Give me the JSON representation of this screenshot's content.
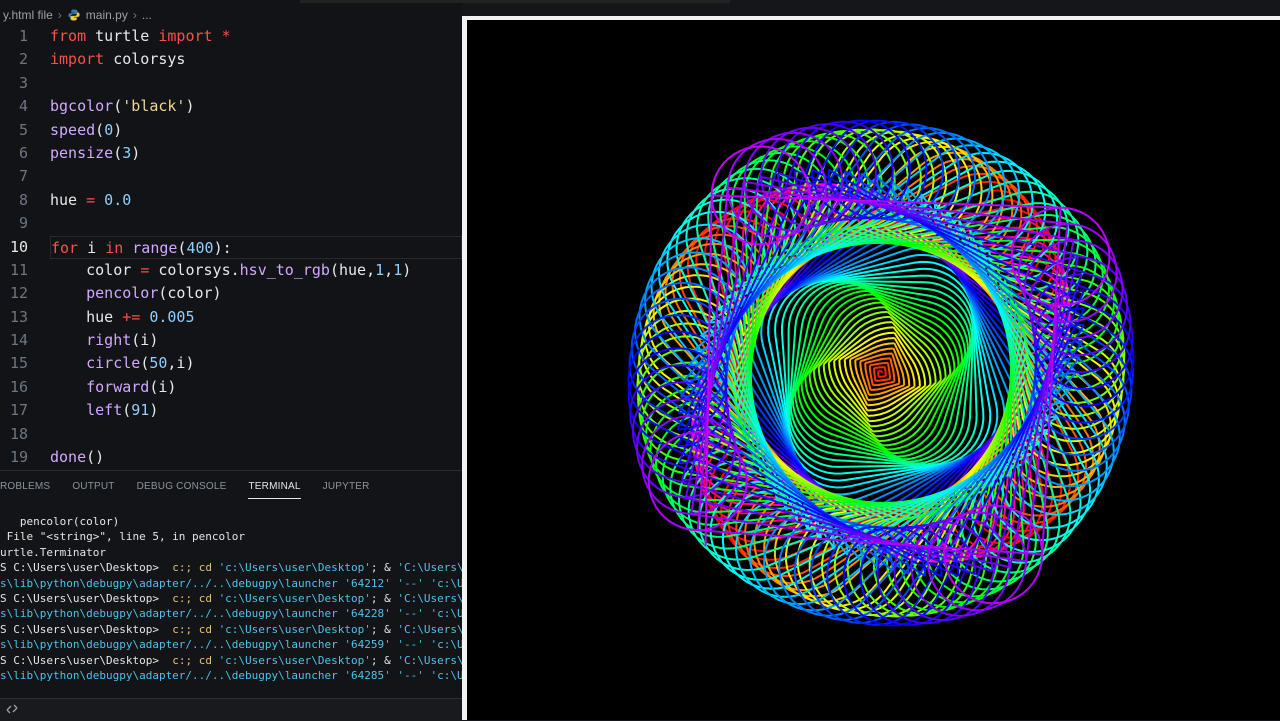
{
  "breadcrumb": {
    "folder": "y.html file",
    "file": "main.py",
    "more": "..."
  },
  "editor": {
    "lines": [
      {
        "n": "1",
        "tokens": [
          [
            "kw",
            "from"
          ],
          [
            "id",
            " turtle "
          ],
          [
            "kw",
            "import"
          ],
          [
            "op",
            " *"
          ]
        ]
      },
      {
        "n": "2",
        "tokens": [
          [
            "kw",
            "import"
          ],
          [
            "id",
            " colorsys"
          ]
        ]
      },
      {
        "n": "3",
        "tokens": []
      },
      {
        "n": "4",
        "tokens": [
          [
            "fn",
            "bgcolor"
          ],
          [
            "id",
            "("
          ],
          [
            "str",
            "'black'"
          ],
          [
            "id",
            ")"
          ]
        ]
      },
      {
        "n": "5",
        "tokens": [
          [
            "fn",
            "speed"
          ],
          [
            "id",
            "("
          ],
          [
            "num",
            "0"
          ],
          [
            "id",
            ")"
          ]
        ]
      },
      {
        "n": "6",
        "tokens": [
          [
            "fn",
            "pensize"
          ],
          [
            "id",
            "("
          ],
          [
            "num",
            "3"
          ],
          [
            "id",
            ")"
          ]
        ]
      },
      {
        "n": "7",
        "tokens": []
      },
      {
        "n": "8",
        "tokens": [
          [
            "id",
            "hue "
          ],
          [
            "op",
            "="
          ],
          [
            "num",
            " 0.0"
          ]
        ]
      },
      {
        "n": "9",
        "tokens": []
      },
      {
        "n": "10",
        "tokens": [
          [
            "kw",
            "for"
          ],
          [
            "id",
            " i "
          ],
          [
            "kw",
            "in"
          ],
          [
            "fn",
            " range"
          ],
          [
            "id",
            "("
          ],
          [
            "num",
            "400"
          ],
          [
            "id",
            "):"
          ]
        ]
      },
      {
        "n": "11",
        "tokens": [
          [
            "id",
            "    color "
          ],
          [
            "op",
            "="
          ],
          [
            "id",
            " colorsys."
          ],
          [
            "fn",
            "hsv_to_rgb"
          ],
          [
            "id",
            "(hue,"
          ],
          [
            "num",
            "1"
          ],
          [
            "id",
            ","
          ],
          [
            "num",
            "1"
          ],
          [
            "id",
            ")"
          ]
        ]
      },
      {
        "n": "12",
        "tokens": [
          [
            "fn",
            "    pencolor"
          ],
          [
            "id",
            "(color)"
          ]
        ]
      },
      {
        "n": "13",
        "tokens": [
          [
            "id",
            "    hue "
          ],
          [
            "op",
            "+="
          ],
          [
            "num",
            " 0.005"
          ]
        ]
      },
      {
        "n": "14",
        "tokens": [
          [
            "fn",
            "    right"
          ],
          [
            "id",
            "(i)"
          ]
        ]
      },
      {
        "n": "15",
        "tokens": [
          [
            "fn",
            "    circle"
          ],
          [
            "id",
            "("
          ],
          [
            "num",
            "50"
          ],
          [
            "id",
            ",i)"
          ]
        ]
      },
      {
        "n": "16",
        "tokens": [
          [
            "fn",
            "    forward"
          ],
          [
            "id",
            "(i)"
          ]
        ]
      },
      {
        "n": "17",
        "tokens": [
          [
            "fn",
            "    left"
          ],
          [
            "id",
            "("
          ],
          [
            "num",
            "91"
          ],
          [
            "id",
            ")"
          ]
        ]
      },
      {
        "n": "18",
        "tokens": []
      },
      {
        "n": "19",
        "tokens": [
          [
            "fn",
            "done"
          ],
          [
            "id",
            "()"
          ]
        ]
      }
    ],
    "active_line": "10"
  },
  "panel": {
    "tabs": [
      "ROBLEMS",
      "OUTPUT",
      "DEBUG CONSOLE",
      "TERMINAL",
      "JUPYTER"
    ],
    "active_tab": "TERMINAL"
  },
  "terminal": {
    "lines": [
      [
        [
          "w",
          "   pencolor(color)"
        ]
      ],
      [
        [
          "w",
          " File \"<string>\", line 5, in pencolor"
        ]
      ],
      [
        [
          "w",
          "urtle.Terminator"
        ]
      ],
      [
        [
          "w",
          "S C:\\Users\\user\\Desktop> "
        ],
        [
          "y",
          " c:; cd "
        ],
        [
          "c",
          "'c:\\Users\\user\\Desktop'"
        ],
        [
          "w",
          "; & "
        ],
        [
          "c",
          "'C:\\Users\\user"
        ]
      ],
      [
        [
          "c",
          "s\\lib\\python\\debugpy\\adapter/../..\\debugpy\\launcher"
        ],
        [
          "w",
          " "
        ],
        [
          "c",
          "'64212'"
        ],
        [
          "w",
          " "
        ],
        [
          "c",
          "'--'"
        ],
        [
          "w",
          " "
        ],
        [
          "c",
          "'c:\\Use"
        ]
      ],
      [
        [
          "w",
          "S C:\\Users\\user\\Desktop> "
        ],
        [
          "y",
          " c:; cd "
        ],
        [
          "c",
          "'c:\\Users\\user\\Desktop'"
        ],
        [
          "w",
          "; & "
        ],
        [
          "c",
          "'C:\\Users\\user"
        ]
      ],
      [
        [
          "c",
          "s\\lib\\python\\debugpy\\adapter/../..\\debugpy\\launcher"
        ],
        [
          "w",
          " "
        ],
        [
          "c",
          "'64228'"
        ],
        [
          "w",
          " "
        ],
        [
          "c",
          "'--'"
        ],
        [
          "w",
          " "
        ],
        [
          "c",
          "'c:\\Use"
        ]
      ],
      [
        [
          "w",
          "S C:\\Users\\user\\Desktop> "
        ],
        [
          "y",
          " c:; cd "
        ],
        [
          "c",
          "'c:\\Users\\user\\Desktop'"
        ],
        [
          "w",
          "; & "
        ],
        [
          "c",
          "'C:\\Users\\user"
        ]
      ],
      [
        [
          "c",
          "s\\lib\\python\\debugpy\\adapter/../..\\debugpy\\launcher"
        ],
        [
          "w",
          " "
        ],
        [
          "c",
          "'64259'"
        ],
        [
          "w",
          " "
        ],
        [
          "c",
          "'--'"
        ],
        [
          "w",
          " "
        ],
        [
          "c",
          "'c:\\Use"
        ]
      ],
      [
        [
          "w",
          "S C:\\Users\\user\\Desktop> "
        ],
        [
          "y",
          " c:; cd "
        ],
        [
          "c",
          "'c:\\Users\\user\\Desktop'"
        ],
        [
          "w",
          "; & "
        ],
        [
          "c",
          "'C:\\Users\\user"
        ]
      ],
      [
        [
          "c",
          "s\\lib\\python\\debugpy\\adapter/../..\\debugpy\\launcher"
        ],
        [
          "w",
          " "
        ],
        [
          "c",
          "'64285'"
        ],
        [
          "w",
          " "
        ],
        [
          "c",
          "'--'"
        ],
        [
          "w",
          " "
        ],
        [
          "c",
          "'c:\\Use"
        ]
      ]
    ]
  },
  "turtle_window": {
    "background": "#000000",
    "drawing": "hsv-spirograph"
  },
  "icons": {
    "file": "python-file-icon",
    "status": "remote-icon"
  }
}
